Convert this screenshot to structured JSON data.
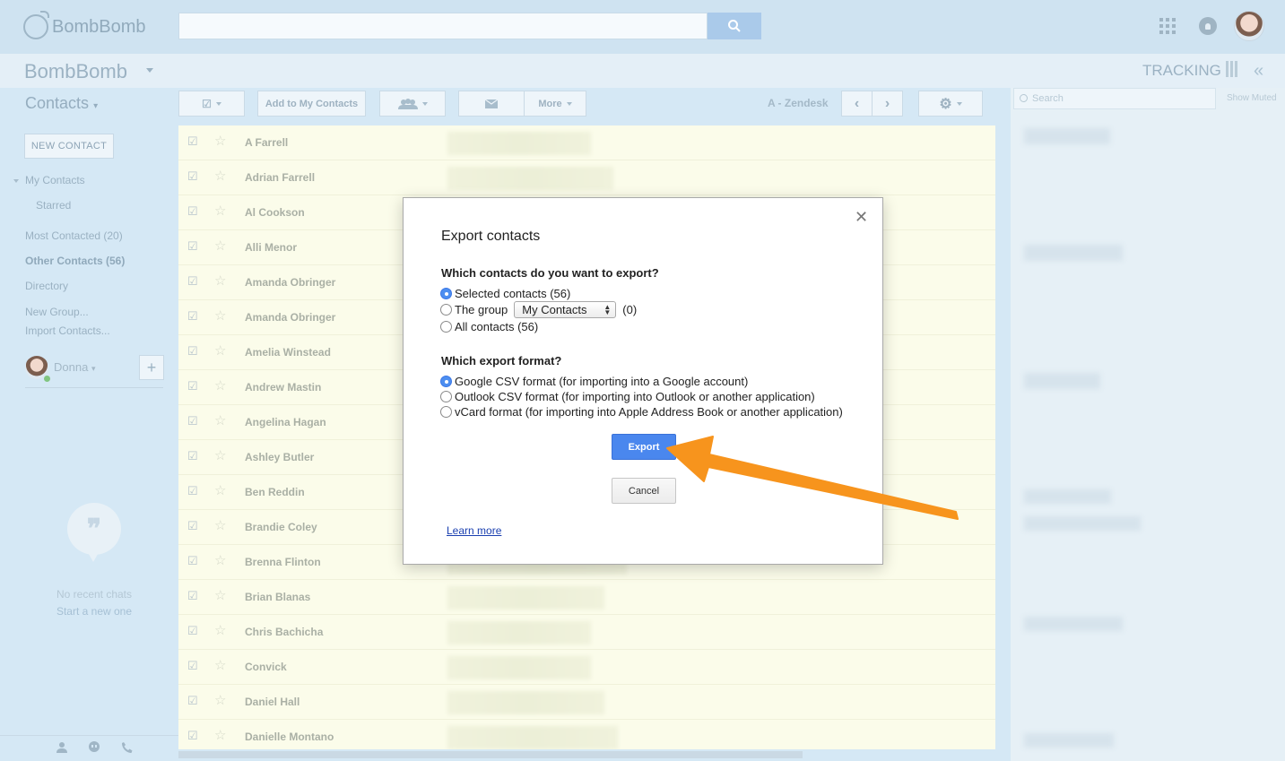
{
  "topbar": {
    "logo_text": "BombBomb",
    "search_placeholder": "",
    "icons": [
      "search-icon",
      "apps-grid-icon",
      "notifications-icon",
      "avatar"
    ]
  },
  "subbar": {
    "brand": "BombBomb",
    "tracking": "TRACKING",
    "icons": [
      "tracking-bars-icon",
      "collapse-double-chevron-icon"
    ]
  },
  "sidebar": {
    "title": "Contacts",
    "new_contact": "NEW CONTACT",
    "items": [
      {
        "label": "My Contacts"
      },
      {
        "label": "Starred"
      },
      {
        "label": "Most Contacted (20)"
      },
      {
        "label": "Other Contacts (56)"
      },
      {
        "label": "Directory"
      },
      {
        "label": "New Group..."
      },
      {
        "label": "Import Contacts..."
      }
    ],
    "user_name": "Donna",
    "add_label": "+",
    "chat": {
      "no_recent": "No recent chats",
      "start_new": "Start a new one"
    }
  },
  "toolbar": {
    "add_to_my_contacts": "Add to My Contacts",
    "more": "More",
    "zendesk": "A - Zendesk",
    "icons": [
      "select-checkbox-icon",
      "group-icon",
      "mail-icon",
      "prev-icon",
      "next-icon",
      "settings-gear-icon"
    ]
  },
  "contacts": [
    "A Farrell",
    "Adrian Farrell",
    "Al Cookson",
    "Alli Menor",
    "Amanda Obringer",
    "Amanda Obringer",
    "Amelia Winstead",
    "Andrew Mastin",
    "Angelina Hagan",
    "Ashley Butler",
    "Ben Reddin",
    "Brandie Coley",
    "Brenna Flinton",
    "Brian Blanas",
    "Chris Bachicha",
    "Convick",
    "Daniel Hall",
    "Danielle Montano"
  ],
  "right_panel": {
    "search_placeholder": "Search",
    "show_muted": "Show Muted"
  },
  "dialog": {
    "title": "Export contacts",
    "question_contacts": "Which contacts do you want to export?",
    "contact_options": {
      "selected": "Selected contacts (56)",
      "group_prefix": "The group",
      "group_value": "My Contacts",
      "group_count": "(0)",
      "all": "All contacts (56)"
    },
    "question_format": "Which export format?",
    "format_options": [
      "Google CSV format (for importing into a Google account)",
      "Outlook CSV format (for importing into Outlook or another application)",
      "vCard format (for importing into Apple Address Book or another application)"
    ],
    "selected_contact_option": "selected",
    "selected_format_option": 0,
    "export_label": "Export",
    "cancel_label": "Cancel",
    "learn_more": "Learn more",
    "close_symbol": "✕"
  },
  "annotation": {
    "arrow_color": "#f7941d"
  }
}
